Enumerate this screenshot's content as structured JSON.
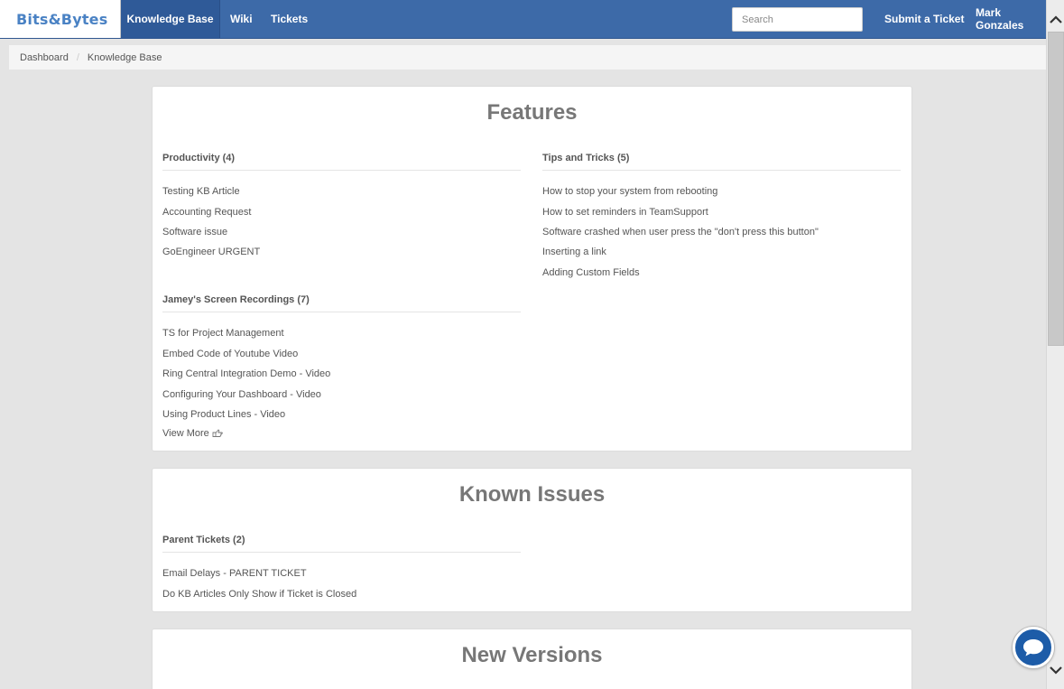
{
  "nav": {
    "brand": "Bits&Bytes",
    "items": [
      {
        "label": "Knowledge Base",
        "active": true
      },
      {
        "label": "Wiki"
      },
      {
        "label": "Tickets"
      }
    ],
    "search_placeholder": "Search",
    "submit_label": "Submit a Ticket",
    "user_name": "Mark Gonzales"
  },
  "breadcrumb": [
    "Dashboard",
    "Knowledge Base"
  ],
  "cards": {
    "features": {
      "title": "Features",
      "productivity": {
        "title": "Productivity (4)",
        "articles": [
          "Testing KB Article",
          "Accounting Request",
          "Software issue",
          "GoEngineer URGENT"
        ]
      },
      "recordings": {
        "title": "Jamey's Screen Recordings (7)",
        "articles": [
          "TS for Project Management",
          "Embed Code of Youtube Video",
          "Ring Central Integration Demo - Video",
          "Configuring Your Dashboard - Video",
          "Using Product Lines - Video"
        ],
        "view_more": "View More"
      },
      "tips": {
        "title": "Tips and Tricks (5)",
        "articles": [
          "How to stop your system from rebooting",
          "How to set reminders in TeamSupport",
          "Software crashed when user press the \"don't press this button\"",
          "Inserting a link",
          "Adding Custom Fields"
        ]
      }
    },
    "known_issues": {
      "title": "Known Issues",
      "parent": {
        "title": "Parent Tickets (2)",
        "articles": [
          "Email Delays - PARENT TICKET",
          "Do KB Articles Only Show if Ticket is Closed"
        ]
      }
    },
    "new_versions": {
      "title": "New Versions"
    }
  },
  "colors": {
    "navbar": "#3d6aa8",
    "brand_text": "#4a82c4",
    "chat_button": "#1d5ca8"
  },
  "icons": [
    "pointing-hand-icon",
    "chat-icon",
    "scroll-up-icon",
    "scroll-down-icon",
    "dropdown-caret-icon"
  ]
}
